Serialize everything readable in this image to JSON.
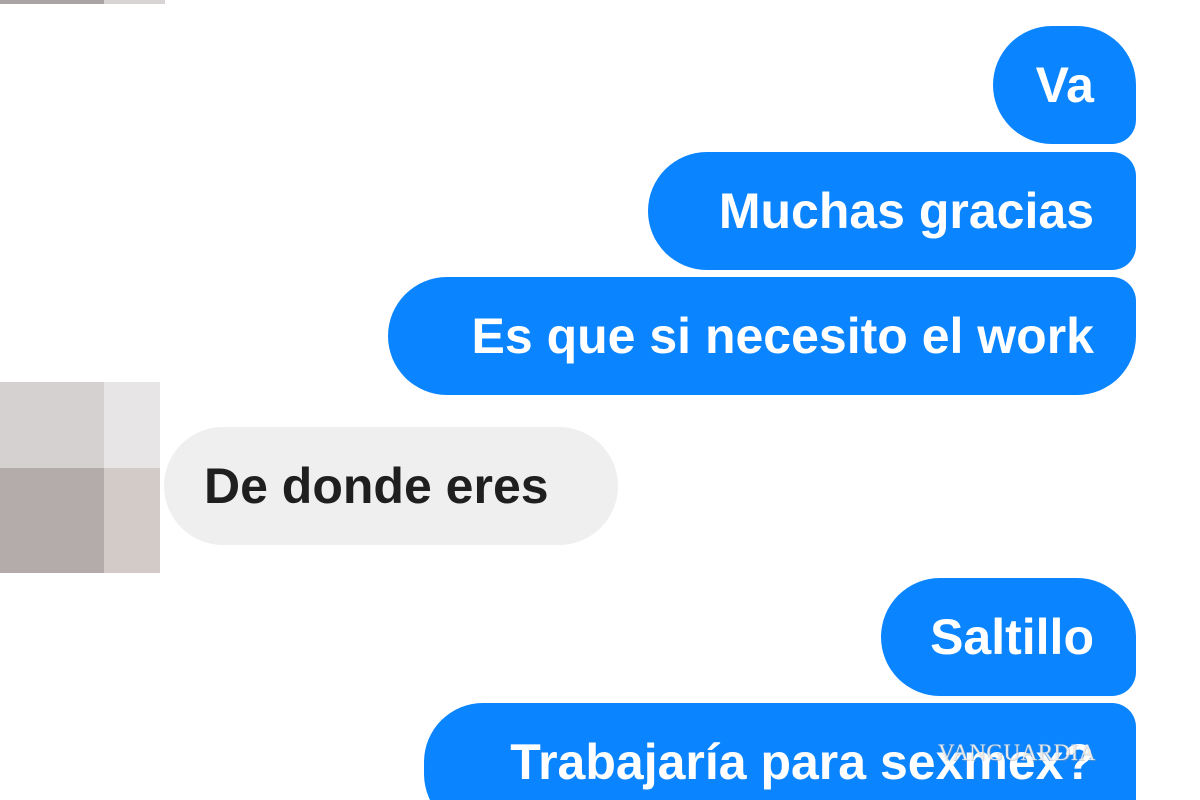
{
  "conversation": {
    "messages": [
      {
        "sender": "me",
        "text": "Va"
      },
      {
        "sender": "me",
        "text": "Muchas gracias"
      },
      {
        "sender": "me",
        "text": "Es que si necesito el work"
      },
      {
        "sender": "other",
        "text": "De donde eres"
      },
      {
        "sender": "me",
        "text": "Saltillo"
      },
      {
        "sender": "me",
        "text": "Trabajaría para sexmex?"
      }
    ]
  },
  "watermark": {
    "text": "VANGUARDIA"
  },
  "colors": {
    "outgoing_bubble": "#0a84ff",
    "incoming_bubble": "#efefef",
    "outgoing_text": "#ffffff",
    "incoming_text": "#1f1f1f",
    "background": "#ffffff"
  },
  "icons": {
    "contact_avatar": "blurred-avatar-icon"
  }
}
